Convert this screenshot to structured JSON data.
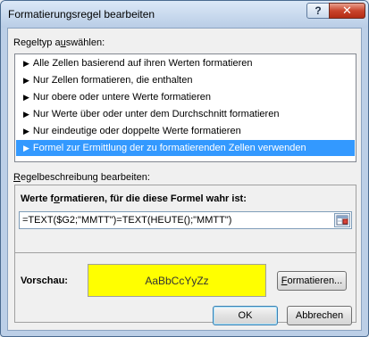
{
  "window": {
    "title": "Formatierungsregel bearbeiten",
    "help_label": "?",
    "close_label": "✕"
  },
  "rule_type": {
    "label_pre": "Regeltyp a",
    "label_accel": "u",
    "label_post": "swählen:",
    "items": [
      {
        "label": "Alle Zellen basierend auf ihren Werten formatieren",
        "selected": false
      },
      {
        "label": "Nur Zellen formatieren, die enthalten",
        "selected": false
      },
      {
        "label": "Nur obere oder untere Werte formatieren",
        "selected": false
      },
      {
        "label": "Nur Werte über oder unter dem Durchschnitt formatieren",
        "selected": false
      },
      {
        "label": "Nur eindeutige oder doppelte Werte formatieren",
        "selected": false
      },
      {
        "label": "Formel zur Ermittlung der zu formatierenden Zellen verwenden",
        "selected": true
      }
    ]
  },
  "description": {
    "label_accel": "R",
    "label_post": "egelbeschreibung bearbeiten:",
    "formula_heading_pre": "Werte f",
    "formula_heading_accel": "o",
    "formula_heading_post": "rmatieren, für die diese Formel wahr ist:",
    "formula_value": "=TEXT($G2;\"MMTT\")=TEXT(HEUTE();\"MMTT\")",
    "preview_label": "Vorschau:",
    "preview_sample": "AaBbCcYyZz",
    "preview_color": "#ffff00",
    "format_button_accel": "F",
    "format_button_post": "ormatieren..."
  },
  "buttons": {
    "ok": "OK",
    "cancel": "Abbrechen"
  },
  "colors": {
    "selection": "#3399ff",
    "titlebar": "#c6d7ec"
  }
}
